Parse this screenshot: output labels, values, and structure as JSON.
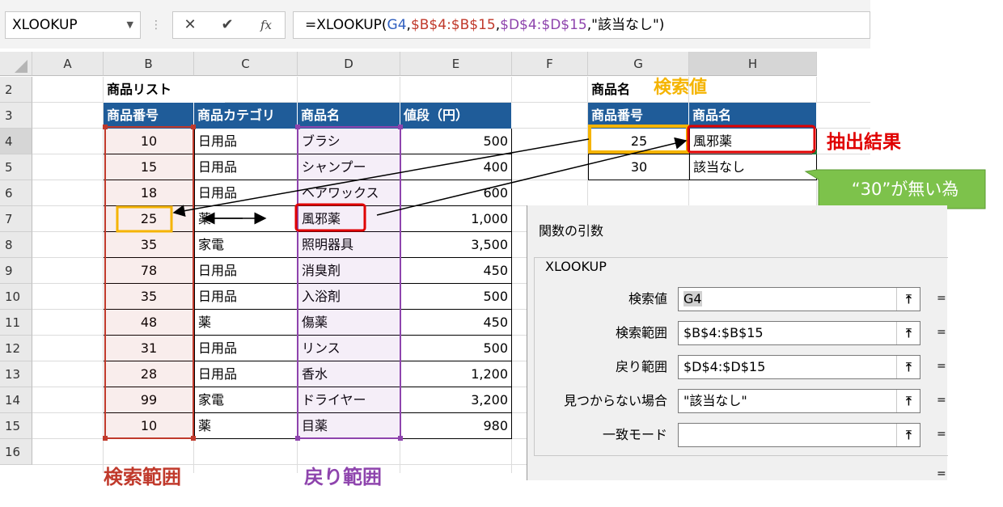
{
  "formula_bar": {
    "name_box": "XLOOKUP",
    "cancel_icon": "✕",
    "enter_icon": "✔",
    "fx_icon": "fx",
    "formula_parts": [
      {
        "text": "=XLOOKUP(",
        "color": "#000000"
      },
      {
        "text": "G4",
        "color": "#2f5fbf"
      },
      {
        "text": ",",
        "color": "#000000"
      },
      {
        "text": "$B$4:$B$15",
        "color": "#c0392b"
      },
      {
        "text": ",",
        "color": "#000000"
      },
      {
        "text": "$D$4:$D$15",
        "color": "#8e44ad"
      },
      {
        "text": ",\"該当なし\")",
        "color": "#000000"
      }
    ]
  },
  "columns": [
    "A",
    "B",
    "C",
    "D",
    "E",
    "F",
    "G",
    "H"
  ],
  "rows": [
    "2",
    "3",
    "4",
    "5",
    "6",
    "7",
    "8",
    "9",
    "10",
    "11",
    "12",
    "13",
    "14",
    "15",
    "16"
  ],
  "product_list": {
    "title": "商品リスト",
    "headers": [
      "商品番号",
      "商品カテゴリ",
      "商品名",
      "値段（円）"
    ],
    "rows": [
      [
        "10",
        "日用品",
        "ブラシ",
        "500"
      ],
      [
        "15",
        "日用品",
        "シャンプー",
        "400"
      ],
      [
        "18",
        "日用品",
        "ヘアワックス",
        "600"
      ],
      [
        "25",
        "薬",
        "風邪薬",
        "1,000"
      ],
      [
        "35",
        "家電",
        "照明器具",
        "3,500"
      ],
      [
        "78",
        "日用品",
        "消臭剤",
        "450"
      ],
      [
        "35",
        "日用品",
        "入浴剤",
        "500"
      ],
      [
        "48",
        "薬",
        "傷薬",
        "450"
      ],
      [
        "31",
        "日用品",
        "リンス",
        "500"
      ],
      [
        "28",
        "日用品",
        "香水",
        "1,200"
      ],
      [
        "99",
        "家電",
        "ドライヤー",
        "3,200"
      ],
      [
        "10",
        "薬",
        "目薬",
        "980"
      ]
    ]
  },
  "lookup": {
    "label": "商品名",
    "search_value_caption": "検索値",
    "headers": [
      "商品番号",
      "商品名"
    ],
    "rows": [
      [
        "25",
        "風邪薬"
      ],
      [
        "30",
        "該当なし"
      ]
    ],
    "result_caption": "抽出結果",
    "note": "“30”が無い為"
  },
  "captions": {
    "search_range": "検索範囲",
    "return_range": "戻り範囲"
  },
  "colors": {
    "header_blue": "#1f5c99",
    "search_range_red": "#c0392b",
    "return_range_purple": "#8e44ad",
    "highlight_orange": "#f5b400",
    "highlight_red": "#e00000",
    "not_found_green": "#7dc24b",
    "caption_orange": "#f5b400"
  },
  "dialog": {
    "title": "関数の引数",
    "function_name": "XLOOKUP",
    "args": [
      {
        "label": "検索値",
        "value": "G4"
      },
      {
        "label": "検索範囲",
        "value": "$B$4:$B$15"
      },
      {
        "label": "戻り範囲",
        "value": "$D$4:$D$15"
      },
      {
        "label": "見つからない場合",
        "value": "\"該当なし\""
      },
      {
        "label": "一致モード",
        "value": ""
      }
    ],
    "collapse_icon": "⤒",
    "equals": "="
  }
}
